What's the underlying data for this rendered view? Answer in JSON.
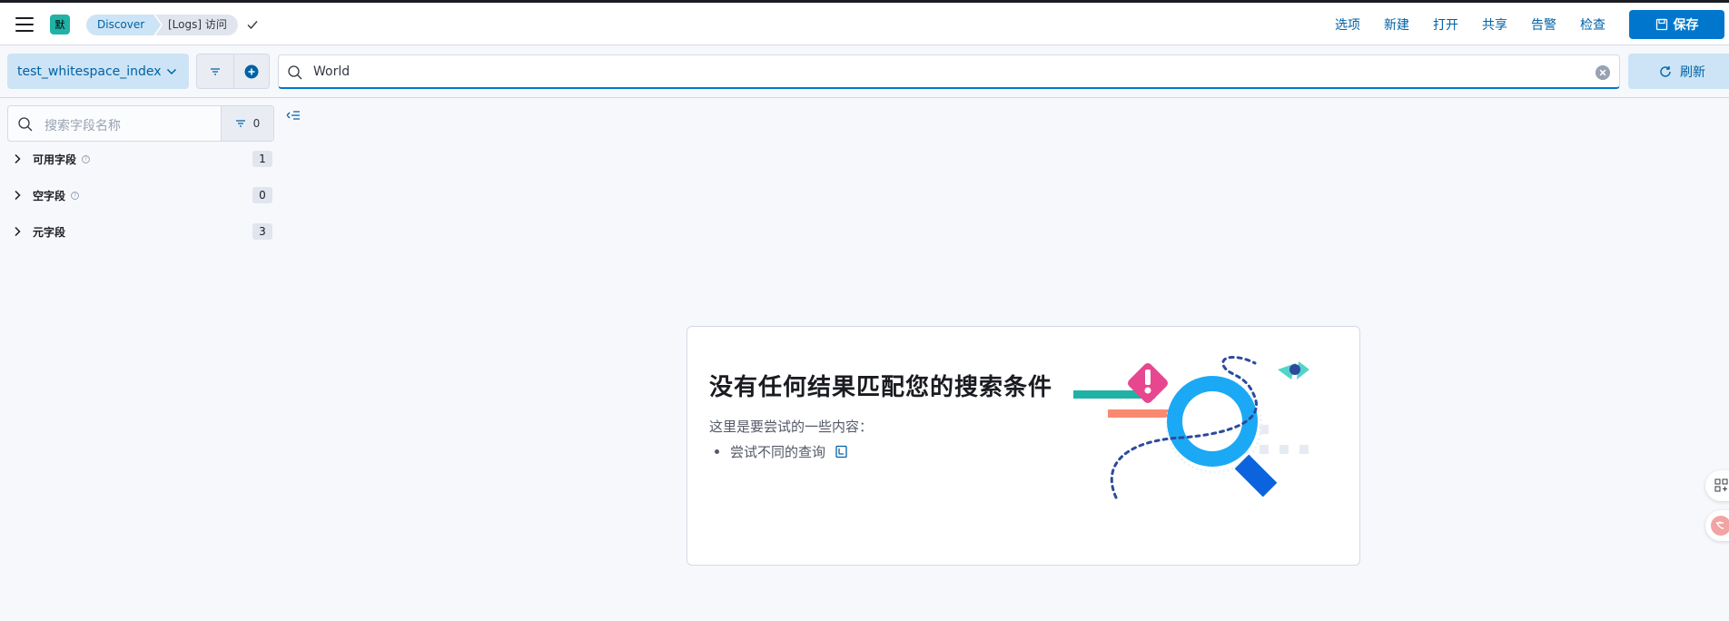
{
  "header": {
    "space_avatar": "默",
    "breadcrumbs": [
      "Discover",
      "[Logs] 访问"
    ],
    "links": [
      "选项",
      "新建",
      "打开",
      "共享",
      "告警",
      "检查"
    ],
    "save_label": "保存"
  },
  "query_bar": {
    "index_pattern": "test_whitespace_index",
    "query": "World",
    "refresh_label": "刷新"
  },
  "sidebar": {
    "search_placeholder": "搜索字段名称",
    "filter_count": "0",
    "groups": [
      {
        "label": "可用字段",
        "count": "1",
        "help": true
      },
      {
        "label": "空字段",
        "count": "0",
        "help": true
      },
      {
        "label": "元字段",
        "count": "3",
        "help": false
      }
    ]
  },
  "empty_state": {
    "title": "没有任何结果匹配您的搜索条件",
    "subtitle": "这里是要尝试的一些内容：",
    "suggestions": [
      "尝试不同的查询"
    ]
  },
  "colors": {
    "primary": "#0077cc",
    "link": "#0061a6",
    "breadcrumb_active": "#cce4f5",
    "space_avatar": "#20b2a6"
  }
}
